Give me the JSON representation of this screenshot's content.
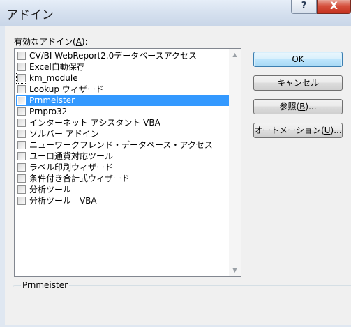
{
  "window": {
    "title": "アドイン",
    "help_glyph": "?",
    "close_glyph": "X"
  },
  "addins": {
    "label": "有効なアドイン",
    "label_key": "A",
    "items": [
      {
        "label": "CV/BI WebReport2.0データベースアクセス",
        "checked": false
      },
      {
        "label": "Excel自動保存",
        "checked": false
      },
      {
        "label": "km_module",
        "checked": false
      },
      {
        "label": "Lookup ウィザード",
        "checked": false
      },
      {
        "label": "Prnmeister",
        "checked": false,
        "selected": true
      },
      {
        "label": "Prnpro32",
        "checked": false
      },
      {
        "label": "インターネット アシスタント VBA",
        "checked": false
      },
      {
        "label": "ソルバー アドイン",
        "checked": false
      },
      {
        "label": "ニューワークフレンド・データベース・アクセス",
        "checked": false
      },
      {
        "label": "ユーロ通貨対応ツール",
        "checked": false
      },
      {
        "label": "ラベル印刷ウィザード",
        "checked": false
      },
      {
        "label": "条件付き合計式ウィザード",
        "checked": false
      },
      {
        "label": "分析ツール",
        "checked": false
      },
      {
        "label": "分析ツール - VBA",
        "checked": false
      }
    ]
  },
  "buttons": {
    "ok": "OK",
    "cancel": "キャンセル",
    "browse": "参照",
    "browse_key": "B",
    "browse_suffix": "...",
    "automation": "オートメーション",
    "automation_key": "U",
    "automation_suffix": "..."
  },
  "description": {
    "title": "Prnmeister",
    "text": ""
  }
}
